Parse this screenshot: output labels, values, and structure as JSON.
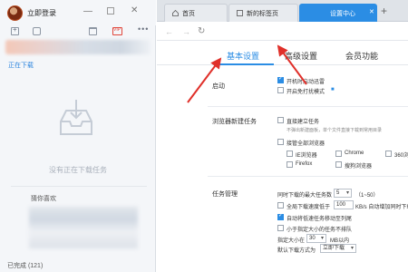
{
  "downloader": {
    "login_text": "立即登录",
    "close_glyph": "✕",
    "more_glyph": "•••",
    "downloading_label": "正在下载",
    "empty_text": "没有正在下载任务",
    "guess_label": "猜你喜欢",
    "completed_text": "已完成 (121)"
  },
  "browser": {
    "tabs": [
      {
        "label": "首页",
        "icon": "home-icon"
      },
      {
        "label": "新的标签页",
        "icon": "page-icon"
      },
      {
        "label": "设置中心",
        "icon": "",
        "active": true
      }
    ],
    "tab_close_glyph": "✕",
    "tab_add_glyph": "+",
    "nav": {
      "back": "←",
      "forward": "→",
      "refresh": "↻"
    }
  },
  "settings": {
    "tabs": [
      {
        "label": "基本设置",
        "active": true
      },
      {
        "label": "高级设置"
      },
      {
        "label": "会员功能"
      }
    ],
    "startup": {
      "label": "启动",
      "options": [
        {
          "label": "开机时启动迅雷",
          "checked": true
        },
        {
          "label": "开启免打扰模式",
          "checked": false,
          "badge": "■"
        }
      ]
    },
    "browser_task": {
      "label": "浏览器新建任务",
      "direct": {
        "label": "直接建立任务",
        "checked": false
      },
      "note": "不弹出新建面板，单个文件直接下载到常用目录",
      "takeover": {
        "label": "接管全部浏览器",
        "checked": false
      },
      "browsers": [
        {
          "label": "IE浏览器",
          "checked": false
        },
        {
          "label": "Chrome",
          "checked": false
        },
        {
          "label": "360浏",
          "checked": false
        },
        {
          "label": "Firefox",
          "checked": false
        },
        {
          "label": "搜狗浏览器",
          "checked": false
        }
      ]
    },
    "task_mgmt": {
      "label": "任务管理",
      "max_tasks_label": "同时下载的最大任务数",
      "max_tasks_value": "5",
      "max_tasks_range": "（1~50）",
      "speed_low": {
        "label": "全局下载速度低于",
        "checked": false,
        "value": "100",
        "suffix": "KB/s 自动增加同时下载"
      },
      "auto_move": {
        "label": "自动将低速任务移动至列尾",
        "checked": true
      },
      "small_first": {
        "label": "小于指定大小的任务不排队",
        "checked": false
      },
      "size_label": "指定大小在",
      "size_value": "30",
      "size_unit": "MB以内",
      "default_mode_label": "默认下载方式为",
      "default_mode_value": "立即下载"
    }
  },
  "colors": {
    "accent": "#2b8de4",
    "annotation_arrow": "#e0302a"
  }
}
